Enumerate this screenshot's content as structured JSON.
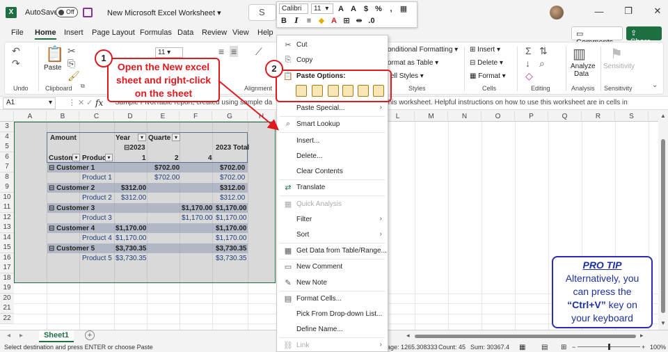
{
  "titlebar": {
    "app_icon": "X",
    "autosave_label": "AutoSave",
    "autosave_state": "Off",
    "document_title": "New Microsoft Excel Worksheet",
    "search_glyph": "S"
  },
  "mini_toolbar": {
    "font_name": "Calibri",
    "font_size": "11",
    "bold": "B",
    "italic": "I"
  },
  "tabs": [
    "File",
    "Home",
    "Insert",
    "Page Layout",
    "Formulas",
    "Data",
    "Review",
    "View",
    "Help"
  ],
  "buttons": {
    "comments": "Comments",
    "share": "Share"
  },
  "ribbon": {
    "undo_label": "Undo",
    "clipboard_label": "Clipboard",
    "paste_label": "Paste",
    "font_size": "11",
    "alignment_label": "Alignment",
    "conditional_formatting": "onditional Formatting",
    "format_as_table": "ormat as Table",
    "cell_styles": "ell Styles",
    "styles_label": "Styles",
    "insert": "Insert",
    "delete": "Delete",
    "format": "Format",
    "cells_label": "Cells",
    "editing_label": "Editing",
    "analyze_data_line1": "Analyze",
    "analyze_data_line2": "Data",
    "analysis_label": "Analysis",
    "sensitivity": "Sensitivity",
    "sensitivity_label": "Sensitivity"
  },
  "formula_bar": {
    "name_box": "A1",
    "fx": "fx",
    "formula_start": "Sample PivotTable report, created using sample da",
    "formula_end": "this worksheet. Helpful instructions on how to use this worksheet are in cells in"
  },
  "columns": [
    "A",
    "B",
    "C",
    "D",
    "E",
    "F",
    "G",
    "H",
    "I",
    "J",
    "K",
    "L",
    "M",
    "N",
    "O",
    "P",
    "Q",
    "R",
    "S"
  ],
  "rows": [
    "3",
    "4",
    "5",
    "6",
    "7",
    "8",
    "9",
    "10",
    "11",
    "12",
    "13",
    "14",
    "15",
    "16",
    "17",
    "18",
    "19",
    "20",
    "21",
    "22"
  ],
  "pivot": {
    "amount": "Amount",
    "year": "Year",
    "quarter": "Quarte",
    "year_value": "2023",
    "year_total": "2023 Total",
    "customer_col": "Custom",
    "product_col": "Produc",
    "q1": "1",
    "q2": "2",
    "q4": "4",
    "rows": [
      {
        "label": "Customer 1",
        "q1": "",
        "q2": "$702.00",
        "q4": "",
        "total": "$702.00"
      },
      {
        "label": "Product 1",
        "q1": "",
        "q2": "$702.00",
        "q4": "",
        "total": "$702.00"
      },
      {
        "label": "Customer 2",
        "q1": "$312.00",
        "q2": "",
        "q4": "",
        "total": "$312.00"
      },
      {
        "label": "Product 2",
        "q1": "$312.00",
        "q2": "",
        "q4": "",
        "total": "$312.00"
      },
      {
        "label": "Customer 3",
        "q1": "",
        "q2": "",
        "q4": "$1,170.00",
        "total": "$1,170.00"
      },
      {
        "label": "Product 3",
        "q1": "",
        "q2": "",
        "q4": "$1,170.00",
        "total": "$1,170.00"
      },
      {
        "label": "Customer 4",
        "q1": "$1,170.00",
        "q2": "",
        "q4": "",
        "total": "$1,170.00"
      },
      {
        "label": "Product 4",
        "q1": "$1,170.00",
        "q2": "",
        "q4": "",
        "total": "$1,170.00"
      },
      {
        "label": "Customer 5",
        "q1": "$3,730.35",
        "q2": "",
        "q4": "",
        "total": "$3,730.35"
      },
      {
        "label": "Product 5",
        "q1": "$3,730.35",
        "q2": "",
        "q4": "",
        "total": "$3,730.35"
      }
    ]
  },
  "context_menu": {
    "cut": "Cut",
    "copy": "Copy",
    "paste_options": "Paste Options:",
    "paste_special": "Paste Special...",
    "smart_lookup": "Smart Lookup",
    "insert": "Insert...",
    "delete": "Delete...",
    "clear_contents": "Clear Contents",
    "translate": "Translate",
    "quick_analysis": "Quick Analysis",
    "filter": "Filter",
    "sort": "Sort",
    "get_data": "Get Data from Table/Range...",
    "new_comment": "New Comment",
    "new_note": "New Note",
    "format_cells": "Format Cells...",
    "pick_dropdown": "Pick From Drop-down List...",
    "define_name": "Define Name...",
    "link": "Link"
  },
  "callout1": {
    "badge": "1",
    "line1": "Open the New excel",
    "line2": "sheet and right-click",
    "line3": "on the sheet"
  },
  "callout2": {
    "badge": "2"
  },
  "protip": {
    "title": "PRO TIP",
    "line1": "Alternatively, you",
    "line2": "can press the",
    "key": "“Ctrl+V”",
    "line3_rest": " key on",
    "line4": "your keyboard"
  },
  "sheet_tabs": {
    "sheet1": "Sheet1",
    "add": "+"
  },
  "status_bar": {
    "message": "Select destination and press ENTER or choose Paste",
    "average": "age: 1265.308333",
    "count": "Count: 45",
    "sum": "Sum: 30367.4",
    "zoom": "100%"
  },
  "colors": {
    "accent": "#1d6f42",
    "callout_red": "#e0191e",
    "protip_blue": "#2b2bb5"
  }
}
